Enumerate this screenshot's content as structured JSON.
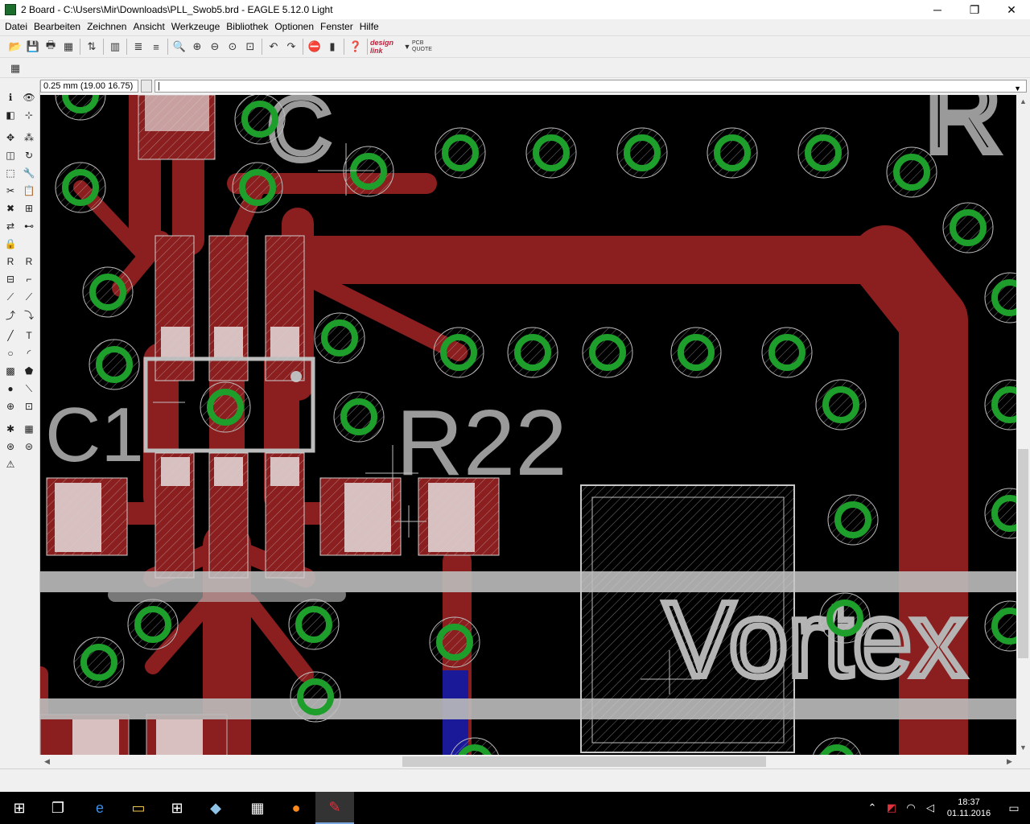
{
  "window": {
    "title": "2 Board - C:\\Users\\Mir\\Downloads\\PLL_Swob5.brd - EAGLE 5.12.0 Light",
    "minimize": "─",
    "maximize": "❐",
    "close": "✕"
  },
  "menu": [
    "Datei",
    "Bearbeiten",
    "Zeichnen",
    "Ansicht",
    "Werkzeuge",
    "Bibliothek",
    "Optionen",
    "Fenster",
    "Hilfe"
  ],
  "toolbar": {
    "designlink_label": "design link",
    "pcbquote_label": "PCB QUOTE"
  },
  "commandbar": {
    "coordinate": "0.25 mm (19.00 16.75)",
    "command": "|"
  },
  "board_text": {
    "c_top": "C",
    "r_top": "R",
    "c1": "C1",
    "r22": "R22",
    "vortex": "Vortex"
  },
  "colors": {
    "top_layer": "#8b1e1e",
    "bottom_layer": "#1a1a99",
    "via": "#1e9e2a",
    "silk": "#b4b4b4",
    "background": "#000000"
  },
  "taskbar": {
    "clock_time": "18:37",
    "clock_date": "01.11.2016"
  }
}
